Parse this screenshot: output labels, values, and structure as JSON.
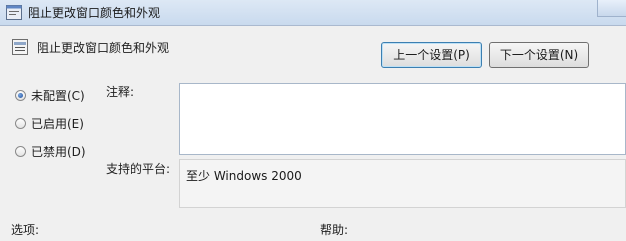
{
  "window": {
    "title": "阻止更改窗口颜色和外观"
  },
  "header": {
    "title": "阻止更改窗口颜色和外观"
  },
  "buttons": {
    "prev": "上一个设置(P)",
    "next": "下一个设置(N)"
  },
  "radios": [
    {
      "label": "未配置(C)",
      "checked": true
    },
    {
      "label": "已启用(E)",
      "checked": false
    },
    {
      "label": "已禁用(D)",
      "checked": false
    }
  ],
  "labels": {
    "comment": "注释:",
    "platform": "支持的平台:",
    "options": "选项:",
    "help": "帮助:"
  },
  "platform": {
    "value": "至少 Windows 2000"
  },
  "colors": {
    "titlebar": "#c9daee",
    "accent": "#3c7fb1",
    "background": "#f0f0f0"
  }
}
